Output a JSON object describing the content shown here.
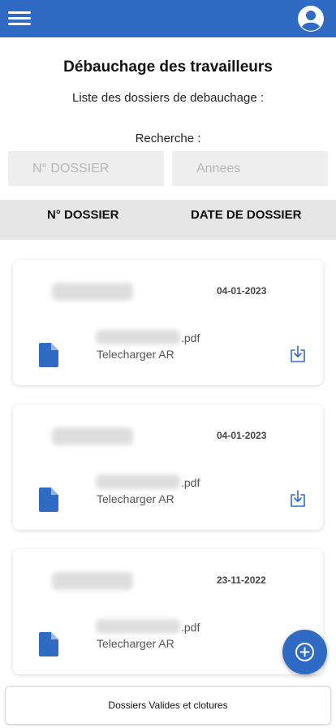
{
  "header": {
    "title": "Débauchage des travailleurs",
    "subtitle": "Liste des dossiers de debauchage :"
  },
  "search": {
    "label": "Recherche :",
    "dossier_placeholder": "N° DOSSIER",
    "annees_placeholder": "Annees"
  },
  "table": {
    "columns": [
      "N° DOSSIER",
      "DATE DE DOSSIER"
    ]
  },
  "cards": [
    {
      "date": "04-01-2023",
      "file_ext": ".pdf",
      "download_label": "Telecharger AR"
    },
    {
      "date": "04-01-2023",
      "file_ext": ".pdf",
      "download_label": "Telecharger AR"
    },
    {
      "date": "23-11-2022",
      "file_ext": ".pdf",
      "download_label": "Telecharger AR"
    }
  ],
  "footer": {
    "button_label": "Dossiers Valides et clotures"
  },
  "icons": {
    "menu": "hamburger-menu-icon",
    "avatar": "account-circle-icon",
    "file": "file-icon",
    "download": "download-icon",
    "add": "add-circle-icon"
  },
  "colors": {
    "primary": "#2f6bc4",
    "table_header_bg": "#e5e5e5",
    "input_bg": "#eeeeee"
  }
}
